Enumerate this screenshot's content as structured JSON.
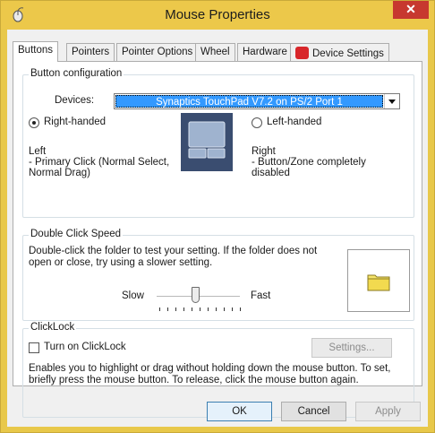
{
  "window": {
    "title": "Mouse Properties",
    "close_glyph": "✕"
  },
  "tabs": [
    {
      "label": "Buttons",
      "active": true
    },
    {
      "label": "Pointers"
    },
    {
      "label": "Pointer Options"
    },
    {
      "label": "Wheel"
    },
    {
      "label": "Hardware"
    },
    {
      "label": "Device Settings",
      "icon": "synaptics-icon"
    }
  ],
  "button_config": {
    "group_label": "Button configuration",
    "devices_label": "Devices:",
    "devices_value": "Synaptics TouchPad V7.2 on PS/2 Port 1",
    "right_handed_label": "Right-handed",
    "left_handed_label": "Left-handed",
    "left_title": "Left",
    "left_desc_1": " - Primary Click (Normal Select,",
    "left_desc_2": "Normal Drag)",
    "right_title": "Right",
    "right_desc_1": " - Button/Zone completely",
    "right_desc_2": "disabled"
  },
  "double_click": {
    "group_label": "Double Click Speed",
    "desc_1": "Double-click the folder to test your setting.  If the folder does not",
    "desc_2": "open or close, try using a slower setting.",
    "slow_label": "Slow",
    "fast_label": "Fast",
    "slider_level": 0.45
  },
  "clicklock": {
    "group_label": "ClickLock",
    "checkbox_label": "Turn on ClickLock",
    "settings_button": "Settings...",
    "desc_1": "Enables you to highlight or drag without holding down the mouse button.  To set,",
    "desc_2": "briefly press the mouse button.  To release, click the mouse button again."
  },
  "footer": {
    "ok": "OK",
    "cancel": "Cancel",
    "apply": "Apply"
  }
}
